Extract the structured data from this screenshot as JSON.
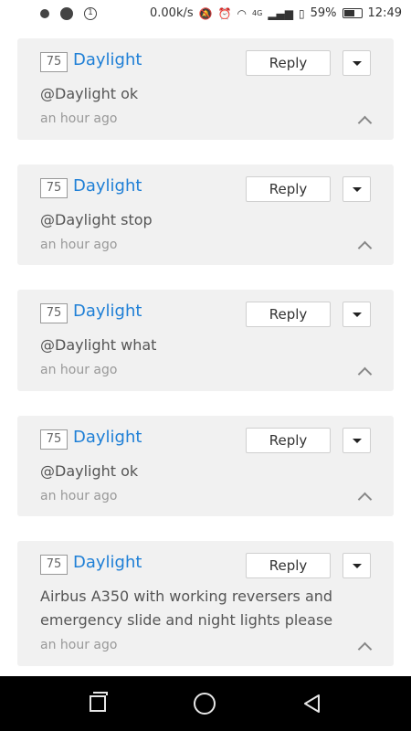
{
  "status_bar": {
    "speed": "0.00k/s",
    "network": "4G",
    "battery_percent": "59%",
    "time": "12:49",
    "left_icons": [
      "notification-dot-icon",
      "chat-bubble-icon",
      "info-circle-icon"
    ],
    "right_icons": [
      "mute-bell-icon",
      "alarm-icon",
      "wifi-icon",
      "signal-bars-icon",
      "sim-icon",
      "battery-icon"
    ]
  },
  "comments": [
    {
      "score": "75",
      "author": "Daylight",
      "reply_label": "Reply",
      "body": "@Daylight ok",
      "time": "an hour ago"
    },
    {
      "score": "75",
      "author": "Daylight",
      "reply_label": "Reply",
      "body": "@Daylight stop",
      "time": "an hour ago"
    },
    {
      "score": "75",
      "author": "Daylight",
      "reply_label": "Reply",
      "body": "@Daylight what",
      "time": "an hour ago"
    },
    {
      "score": "75",
      "author": "Daylight",
      "reply_label": "Reply",
      "body": "@Daylight ok",
      "time": "an hour ago"
    },
    {
      "score": "75",
      "author": "Daylight",
      "reply_label": "Reply",
      "body": "Airbus A350 with working reversers and emergency slide and night lights please",
      "time": "an hour ago"
    }
  ],
  "colors": {
    "author_link": "#1e7fd6",
    "card_bg": "#f1f1f1",
    "navbar_bg": "#000000"
  },
  "nav_bar": {
    "icons": [
      "recents-icon",
      "home-icon",
      "back-icon"
    ]
  }
}
